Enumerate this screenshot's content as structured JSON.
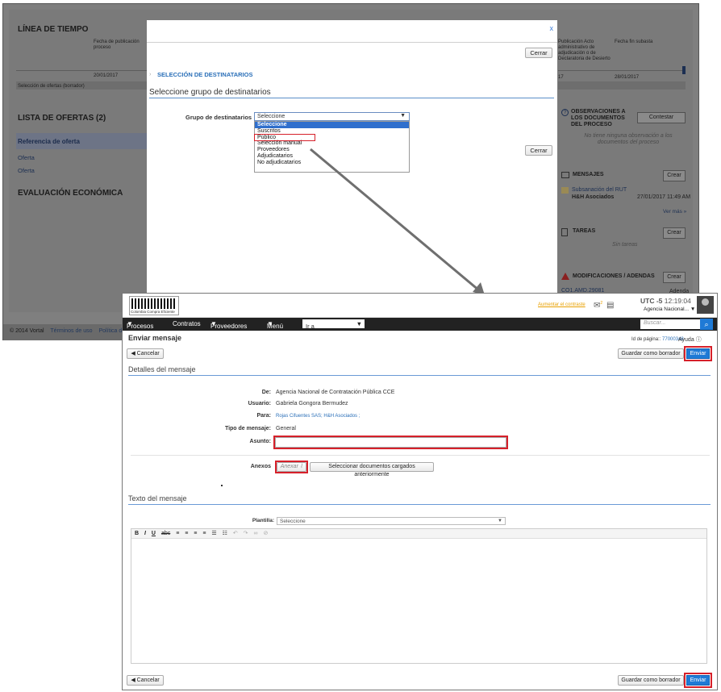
{
  "background": {
    "timeline_title": "LÍNEA DE TIEMPO",
    "timeline_col1": "Fecha de publicación proceso",
    "timeline_date1": "20/01/2017",
    "timeline_row_label": "Selección de ofertas (borrador)",
    "timeline_col2": "Publicación Acto administrativo de adjudicación o de Declaratoria de Desierto",
    "timeline_col3": "Fecha fin subasta",
    "timeline_date2": "17",
    "timeline_date3": "28/01/2017",
    "offers_title": "LISTA DE OFERTAS (2)",
    "offers_col": "Referencia de oferta",
    "offer1": "Oferta",
    "offer2": "Oferta",
    "eval_title": "EVALUACIÓN ECONÓMICA",
    "obs_title": "OBSERVACIONES A LOS DOCUMENTOS DEL PROCESO",
    "obs_button": "Contestar",
    "obs_empty": "No tiene ninguna observación a los documentos del proceso",
    "msgs_title": "MENSAJES",
    "msgs_button": "Crear",
    "msg_subject": "Subsanación del RUT",
    "msg_sender": "H&H Asociados",
    "msg_date": "27/01/2017 11:49 AM",
    "see_more": "Ver más »",
    "tasks_title": "TAREAS",
    "tasks_button": "Crear",
    "tasks_empty": "Sin tareas",
    "mods_title": "MODIFICACIONES / ADENDAS",
    "mods_button": "Crear",
    "mod_ref": "CO1.AMD.29081",
    "mod_type": "Adenda",
    "footer_copy": "© 2014 Vortal",
    "footer_terms": "Términos de uso",
    "footer_policy": "Política de"
  },
  "modal": {
    "close": "x",
    "close_top": "Cerrar",
    "close_mid": "Cerrar",
    "section_title": "SELECCIÓN DE DESTINATARIOS",
    "subtitle": "Seleccione grupo de destinatarios",
    "group_label": "Grupo de destinatarios",
    "dropdown_value": "Seleccione",
    "options": [
      "Seleccione",
      "Suscritos",
      "Público",
      "Selección manual",
      "Proveedores",
      "Adjudicatarios",
      "No adjudicatarios"
    ]
  },
  "front": {
    "logo_caption": "Colombia Compra Eficiente",
    "increase_contrast": "Aumentar el contraste",
    "notif_count": "2",
    "utc": "UTC -5",
    "time": "12:19:04",
    "agency": "Agencia Nacional...",
    "nav": {
      "procesos": "Procesos",
      "contratos": "Contratos",
      "proveedores": "Proveedores",
      "menu": "Menú",
      "ira": "Ir a",
      "search_placeholder": "Buscar..."
    },
    "page_title": "Enviar mensaje",
    "page_id_label": "Id de página::",
    "page_id": "77000348",
    "help": "Ayuda",
    "cancel": "Cancelar",
    "save_draft": "Guardar como borrador",
    "send": "Enviar",
    "details_title": "Detalles del mensaje",
    "from_label": "De:",
    "from_value": "Agencia Nacional de Contratación Pública CCE",
    "user_label": "Usuario:",
    "user_value": "Gabriela Gongora Bermudez",
    "to_label": "Para:",
    "to_value": "Rojas Cifuentes SAS; H&H Asociados ;",
    "type_label": "Tipo de mensaje:",
    "type_value": "General",
    "subject_label": "Asunto:",
    "subject_value": "",
    "attachments_label": "Anexos",
    "attach_button": "Anexar",
    "select_docs_button": "Seleccionar documentos cargados anteriormente",
    "body_title": "Texto del mensaje",
    "template_label": "Plantilla:",
    "template_value": "Seleccione"
  }
}
